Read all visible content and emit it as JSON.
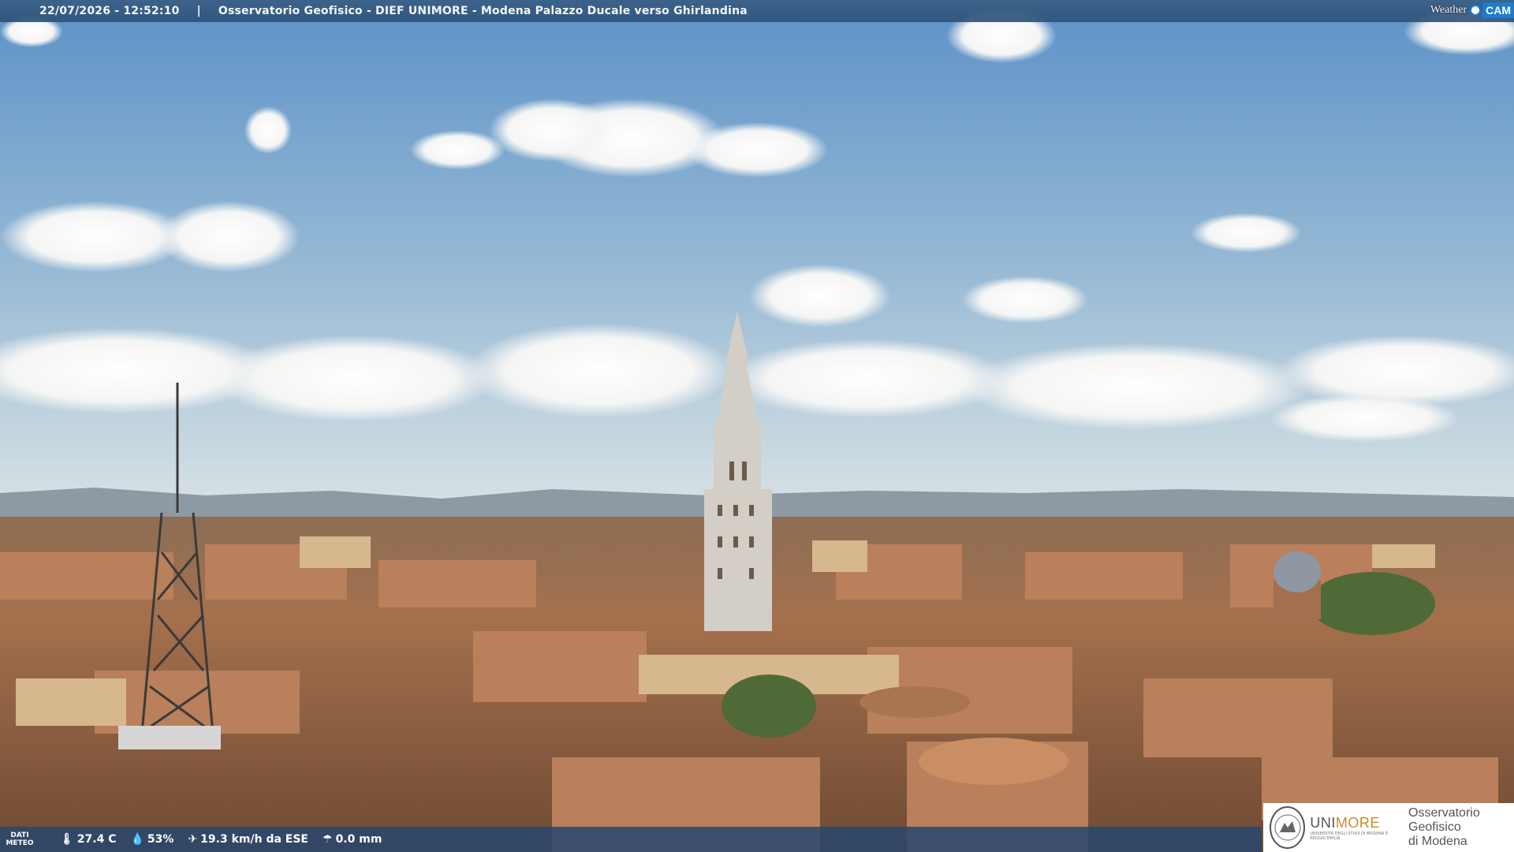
{
  "header": {
    "timestamp": "22/07/2026 - 12:52:10",
    "separator": "|",
    "caption": "Osservatorio Geofisico - DIEF UNIMORE - Modena Palazzo Ducale verso Ghirlandina"
  },
  "brand": {
    "weather": "Weather",
    "cam": "CAM"
  },
  "meteo": {
    "label_line1": "DATI",
    "label_line2": "METEO",
    "temperature": "27.4 C",
    "humidity": "53%",
    "wind": "19.3 km/h da ESE",
    "rain": "0.0 mm"
  },
  "logo": {
    "uni_prefix": "UNI",
    "uni_suffix": "MORE",
    "uni_small": "UNIVERSITÀ DEGLI STUDI DI MODENA E REGGIO EMILIA",
    "obs_line1": "Osservatorio Geofisico",
    "obs_line2": "di Modena"
  },
  "colors": {
    "sky_top": "#5f93c8",
    "sky_bottom": "#c8d8e2",
    "roof": "#b87a55",
    "tower": "#cfcac2"
  }
}
